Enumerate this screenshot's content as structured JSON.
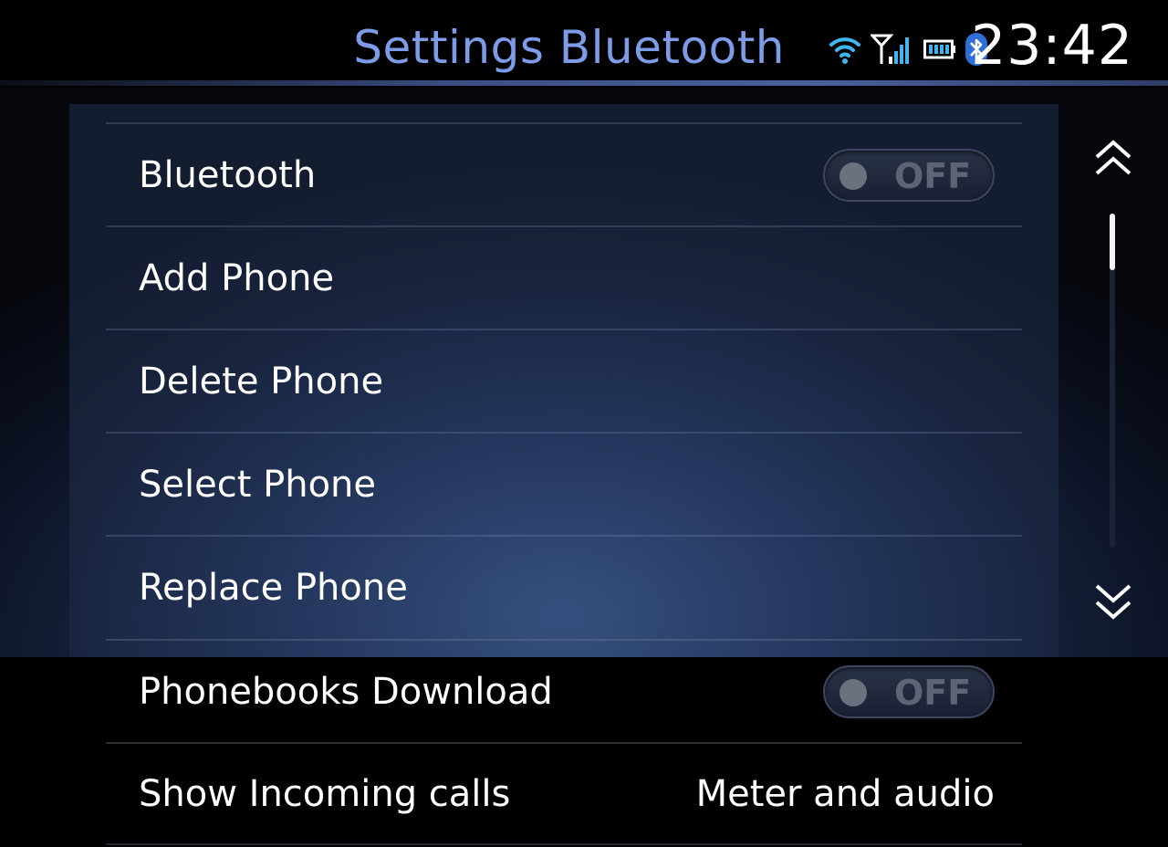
{
  "header": {
    "title": "Settings Bluetooth",
    "clock": "23:42",
    "status_icons": [
      "wifi-icon",
      "cellular-signal-icon",
      "battery-icon",
      "bluetooth-icon"
    ],
    "title_color": "#7d9be8"
  },
  "settings": {
    "items": [
      {
        "label": "Bluetooth",
        "control": "toggle",
        "state": "OFF"
      },
      {
        "label": "Add Phone"
      },
      {
        "label": "Delete Phone"
      },
      {
        "label": "Select Phone"
      },
      {
        "label": "Replace Phone"
      },
      {
        "label": "Phonebooks Download",
        "control": "toggle",
        "state": "OFF"
      },
      {
        "label": "Show Incoming calls",
        "value": "Meter and audio"
      }
    ]
  },
  "scroll": {
    "up_icon": "double-chevron-up-icon",
    "down_icon": "double-chevron-down-icon",
    "position_fraction": 0.0,
    "visible_fraction": 0.17
  },
  "colors": {
    "accent": "#7d9be8",
    "toggle_off_text": "#5e6474"
  }
}
